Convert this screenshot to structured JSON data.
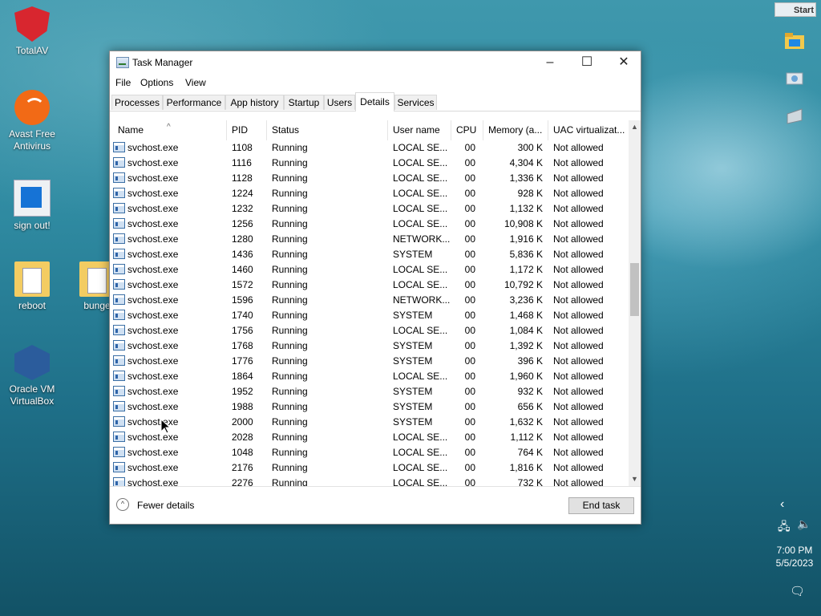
{
  "desktop": {
    "icons": [
      {
        "label": "TotalAV",
        "icon": "totalav-icon"
      },
      {
        "label": "Avast Free Antivirus",
        "icon": "avast-icon"
      },
      {
        "label": "sign out!",
        "icon": "signout-icon"
      },
      {
        "label": "reboot",
        "icon": "folder-icon"
      },
      {
        "label": "bunge",
        "icon": "folder-icon"
      },
      {
        "label": "Oracle VM VirtualBox",
        "icon": "virtualbox-icon"
      }
    ]
  },
  "sidebar": {
    "start_label": "Start",
    "clock_time": "7:00 PM",
    "clock_date": "5/5/2023"
  },
  "window": {
    "title": "Task Manager",
    "menu": [
      "File",
      "Options",
      "View"
    ],
    "tabs": [
      "Processes",
      "Performance",
      "App history",
      "Startup",
      "Users",
      "Details",
      "Services"
    ],
    "active_tab": "Details",
    "columns": [
      "Name",
      "PID",
      "Status",
      "User name",
      "CPU",
      "Memory (a...",
      "UAC virtualizat..."
    ],
    "rows": [
      {
        "name": "svchost.exe",
        "pid": "1108",
        "status": "Running",
        "user": "LOCAL SE...",
        "cpu": "00",
        "mem": "300 K",
        "uac": "Not allowed"
      },
      {
        "name": "svchost.exe",
        "pid": "1116",
        "status": "Running",
        "user": "LOCAL SE...",
        "cpu": "00",
        "mem": "4,304 K",
        "uac": "Not allowed"
      },
      {
        "name": "svchost.exe",
        "pid": "1128",
        "status": "Running",
        "user": "LOCAL SE...",
        "cpu": "00",
        "mem": "1,336 K",
        "uac": "Not allowed"
      },
      {
        "name": "svchost.exe",
        "pid": "1224",
        "status": "Running",
        "user": "LOCAL SE...",
        "cpu": "00",
        "mem": "928 K",
        "uac": "Not allowed"
      },
      {
        "name": "svchost.exe",
        "pid": "1232",
        "status": "Running",
        "user": "LOCAL SE...",
        "cpu": "00",
        "mem": "1,132 K",
        "uac": "Not allowed"
      },
      {
        "name": "svchost.exe",
        "pid": "1256",
        "status": "Running",
        "user": "LOCAL SE...",
        "cpu": "00",
        "mem": "10,908 K",
        "uac": "Not allowed"
      },
      {
        "name": "svchost.exe",
        "pid": "1280",
        "status": "Running",
        "user": "NETWORK...",
        "cpu": "00",
        "mem": "1,916 K",
        "uac": "Not allowed"
      },
      {
        "name": "svchost.exe",
        "pid": "1436",
        "status": "Running",
        "user": "SYSTEM",
        "cpu": "00",
        "mem": "5,836 K",
        "uac": "Not allowed"
      },
      {
        "name": "svchost.exe",
        "pid": "1460",
        "status": "Running",
        "user": "LOCAL SE...",
        "cpu": "00",
        "mem": "1,172 K",
        "uac": "Not allowed"
      },
      {
        "name": "svchost.exe",
        "pid": "1572",
        "status": "Running",
        "user": "LOCAL SE...",
        "cpu": "00",
        "mem": "10,792 K",
        "uac": "Not allowed"
      },
      {
        "name": "svchost.exe",
        "pid": "1596",
        "status": "Running",
        "user": "NETWORK...",
        "cpu": "00",
        "mem": "3,236 K",
        "uac": "Not allowed"
      },
      {
        "name": "svchost.exe",
        "pid": "1740",
        "status": "Running",
        "user": "SYSTEM",
        "cpu": "00",
        "mem": "1,468 K",
        "uac": "Not allowed"
      },
      {
        "name": "svchost.exe",
        "pid": "1756",
        "status": "Running",
        "user": "LOCAL SE...",
        "cpu": "00",
        "mem": "1,084 K",
        "uac": "Not allowed"
      },
      {
        "name": "svchost.exe",
        "pid": "1768",
        "status": "Running",
        "user": "SYSTEM",
        "cpu": "00",
        "mem": "1,392 K",
        "uac": "Not allowed"
      },
      {
        "name": "svchost.exe",
        "pid": "1776",
        "status": "Running",
        "user": "SYSTEM",
        "cpu": "00",
        "mem": "396 K",
        "uac": "Not allowed"
      },
      {
        "name": "svchost.exe",
        "pid": "1864",
        "status": "Running",
        "user": "LOCAL SE...",
        "cpu": "00",
        "mem": "1,960 K",
        "uac": "Not allowed"
      },
      {
        "name": "svchost.exe",
        "pid": "1952",
        "status": "Running",
        "user": "SYSTEM",
        "cpu": "00",
        "mem": "932 K",
        "uac": "Not allowed"
      },
      {
        "name": "svchost.exe",
        "pid": "1988",
        "status": "Running",
        "user": "SYSTEM",
        "cpu": "00",
        "mem": "656 K",
        "uac": "Not allowed"
      },
      {
        "name": "svchost.exe",
        "pid": "2000",
        "status": "Running",
        "user": "SYSTEM",
        "cpu": "00",
        "mem": "1,632 K",
        "uac": "Not allowed"
      },
      {
        "name": "svchost.exe",
        "pid": "2028",
        "status": "Running",
        "user": "LOCAL SE...",
        "cpu": "00",
        "mem": "1,112 K",
        "uac": "Not allowed"
      },
      {
        "name": "svchost.exe",
        "pid": "1048",
        "status": "Running",
        "user": "LOCAL SE...",
        "cpu": "00",
        "mem": "764 K",
        "uac": "Not allowed"
      },
      {
        "name": "svchost.exe",
        "pid": "2176",
        "status": "Running",
        "user": "LOCAL SE...",
        "cpu": "00",
        "mem": "1,816 K",
        "uac": "Not allowed"
      },
      {
        "name": "svchost.exe",
        "pid": "2276",
        "status": "Running",
        "user": "LOCAL SE...",
        "cpu": "00",
        "mem": "732 K",
        "uac": "Not allowed"
      }
    ],
    "fewer_details": "Fewer details",
    "end_task": "End task"
  }
}
